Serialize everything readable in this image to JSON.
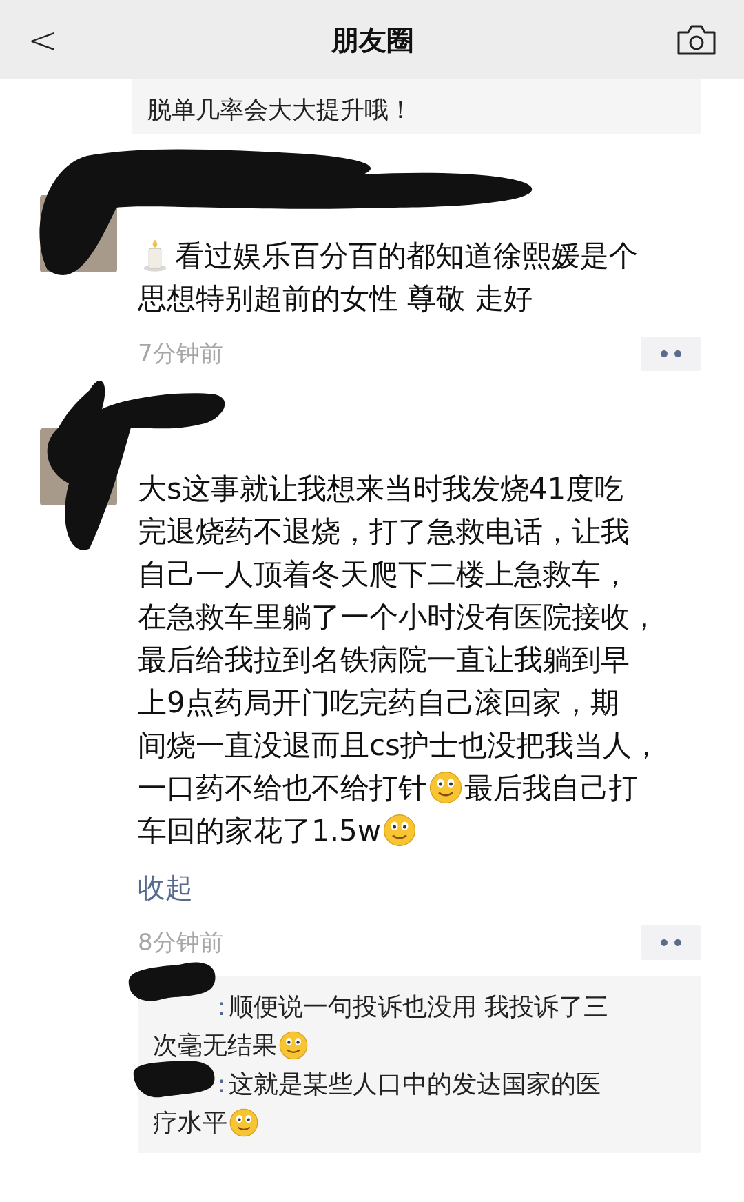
{
  "header": {
    "back": "<",
    "title": "朋友圈"
  },
  "top_comment": {
    "text": "脱单几率会大大提升哦！"
  },
  "posts": [
    {
      "lines": [
        [
          {
            "kind": "candle"
          },
          {
            "kind": "text",
            "text": "看过娱乐百分百的都知道徐熙媛是个"
          }
        ],
        [
          {
            "kind": "text",
            "text": "思想特别超前的女性 尊敬 走好"
          }
        ]
      ],
      "time": "7分钟前"
    },
    {
      "lines": [
        [
          {
            "kind": "text",
            "text": "大s这事就让我想来当时我发烧41度吃"
          }
        ],
        [
          {
            "kind": "text",
            "text": "完退烧药不退烧，打了急救电话，让我"
          }
        ],
        [
          {
            "kind": "text",
            "text": "自己一人顶着冬天爬下二楼上急救车，"
          }
        ],
        [
          {
            "kind": "text",
            "text": "在急救车里躺了一个小时没有医院接收，"
          }
        ],
        [
          {
            "kind": "text",
            "text": "最后给我拉到名铁病院一直让我躺到早"
          }
        ],
        [
          {
            "kind": "text",
            "text": "上9点药局开门吃完药自己滚回家，期"
          }
        ],
        [
          {
            "kind": "text",
            "text": "间烧一直没退而且cs护士也没把我当人，"
          }
        ],
        [
          {
            "kind": "text",
            "text": "一口药不给也不给打针"
          },
          {
            "kind": "smile"
          },
          {
            "kind": "text",
            "text": "最后我自己打"
          }
        ],
        [
          {
            "kind": "text",
            "text": "车回的家花了1.5w"
          },
          {
            "kind": "smile"
          }
        ]
      ],
      "time": "8分钟前",
      "collapse": "收起",
      "comments": [
        {
          "separator": ":",
          "lines": [
            [
              {
                "kind": "text",
                "text": "顺便说一句投诉也没用 我投诉了三"
              }
            ],
            [
              {
                "kind": "text",
                "text": "次毫无结果"
              },
              {
                "kind": "smile"
              }
            ]
          ]
        },
        {
          "separator": ":",
          "lines": [
            [
              {
                "kind": "text",
                "text": "这就是某些人口中的发达国家的医"
              }
            ],
            [
              {
                "kind": "text",
                "text": "疗水平"
              },
              {
                "kind": "smile"
              }
            ]
          ]
        }
      ]
    }
  ]
}
